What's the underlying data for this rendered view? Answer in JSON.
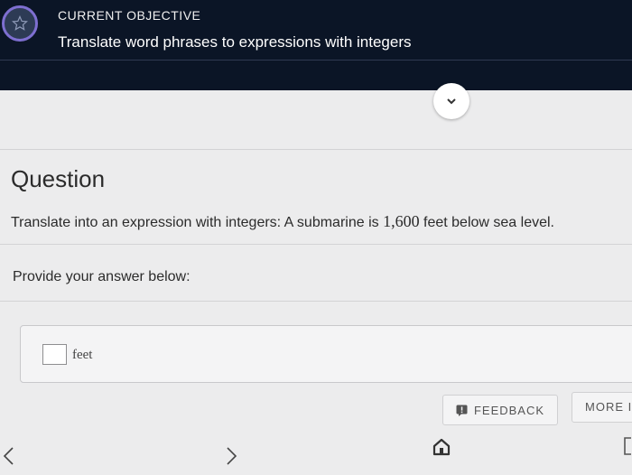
{
  "header": {
    "objective_label": "CURRENT OBJECTIVE",
    "objective_title": "Translate word phrases to expressions with integers"
  },
  "question": {
    "heading": "Question",
    "prompt_prefix": "Translate into an expression with integers: A submarine is ",
    "prompt_number": "1,600",
    "prompt_suffix": " feet below sea level."
  },
  "answer": {
    "instruction": "Provide your answer below:",
    "input_value": "",
    "unit": "feet"
  },
  "footer": {
    "feedback_label": "FEEDBACK",
    "more_label": "MORE I"
  },
  "colors": {
    "header_bg": "#0b1526",
    "badge_ring": "#7e6fd1",
    "panel_bg": "#ececed"
  },
  "icons": [
    "star-icon",
    "chevron-down-icon",
    "feedback-icon",
    "chevron-left-icon",
    "chevron-right-icon",
    "home-icon"
  ]
}
